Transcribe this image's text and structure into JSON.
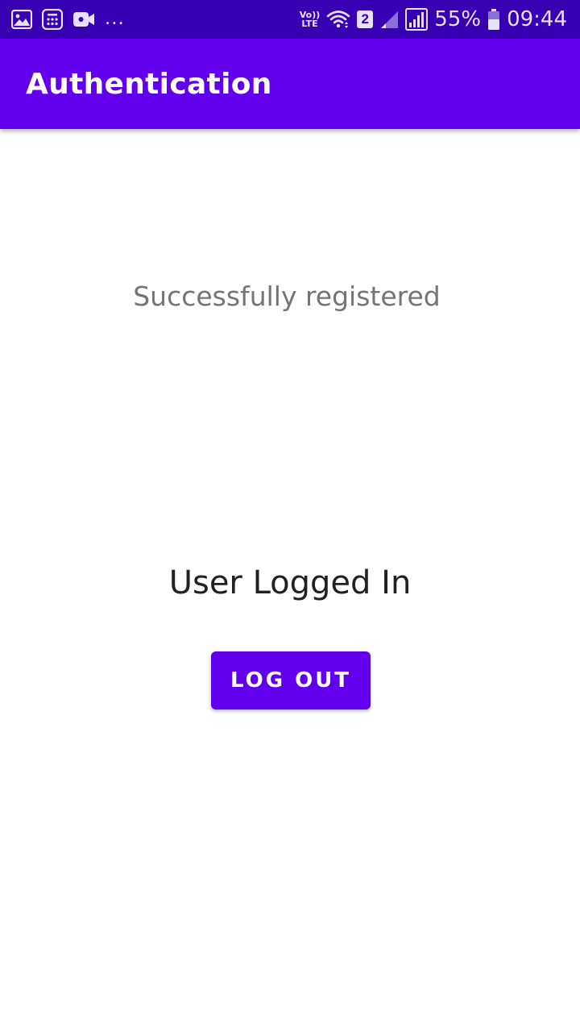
{
  "status_bar": {
    "left_icons": [
      "gallery-icon",
      "calculator-icon",
      "video-icon"
    ],
    "overflow": "...",
    "volte_line1": "Vo))",
    "volte_line2": "LTE",
    "sim_slot": "2",
    "battery_percent": "55%",
    "time": "09:44",
    "colors": {
      "background": "#3700b3",
      "foreground": "#e8e0ff"
    }
  },
  "app_bar": {
    "title": "Authentication",
    "color": "#6200ee"
  },
  "main": {
    "message": "Successfully registered",
    "status": "User Logged In",
    "logout_label": "LOG OUT"
  }
}
